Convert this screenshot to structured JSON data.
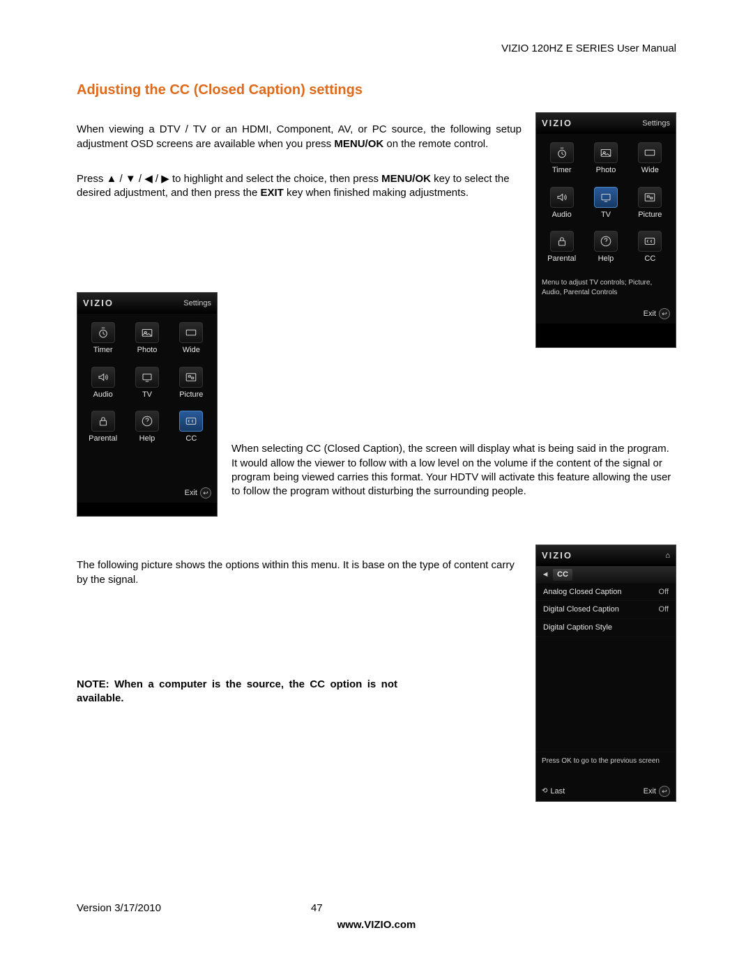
{
  "doc": {
    "header": "VIZIO 120HZ E SERIES User Manual",
    "title": "Adjusting the CC (Closed Caption) settings",
    "para1_a": "When viewing a DTV / TV or an HDMI, Component, AV, or PC source, the following setup adjustment OSD screens are available when you press ",
    "para1_bold": "MENU/OK",
    "para1_c": " on the remote control.",
    "para2_a": "Press ▲ / ▼ / ◀ / ▶ to highlight and select the choice, then press ",
    "para2_bold1": "MENU/OK",
    "para2_b": " key to select the desired adjustment, and then press the ",
    "para2_bold2": "EXIT",
    "para2_c": " key when finished making adjustments.",
    "para3": "When selecting CC (Closed Caption), the screen will display what is being said in the program. It would allow the viewer to follow with a low level on the volume if the content of the signal or program being viewed carries this format. Your HDTV will activate this feature allowing the user to follow the program without disturbing the surrounding people.",
    "para4": "The following picture shows the options within this menu. It is base on the type of content carry by the signal.",
    "note": "NOTE: When a computer is the source, the CC option is not available.",
    "footer_version": "Version 3/17/2010",
    "footer_page": "47",
    "footer_url": "www.VIZIO.com"
  },
  "osd_shared": {
    "brand": "VIZIO",
    "tab": "Settings",
    "exit_lbl": "Exit",
    "last_lbl": "Last",
    "tiles": [
      {
        "name": "timer",
        "label": "Timer"
      },
      {
        "name": "photo",
        "label": "Photo"
      },
      {
        "name": "wide",
        "label": "Wide"
      },
      {
        "name": "audio",
        "label": "Audio"
      },
      {
        "name": "tv",
        "label": "TV"
      },
      {
        "name": "picture",
        "label": "Picture"
      },
      {
        "name": "parental",
        "label": "Parental"
      },
      {
        "name": "help",
        "label": "Help"
      },
      {
        "name": "cc",
        "label": "CC"
      }
    ]
  },
  "osd_tv": {
    "selected": "tv",
    "hint": "Menu to adjust TV controls; Picture, Audio, Parental Controls"
  },
  "osd_cc_grid": {
    "selected": "cc",
    "hint": ""
  },
  "osd_cc_list": {
    "breadcrumb": "CC",
    "items": [
      {
        "label": "Analog Closed Caption",
        "value": "Off"
      },
      {
        "label": "Digital Closed Caption",
        "value": "Off"
      },
      {
        "label": "Digital Caption Style",
        "value": ""
      }
    ],
    "hint": "Press OK to go to the previous screen"
  }
}
